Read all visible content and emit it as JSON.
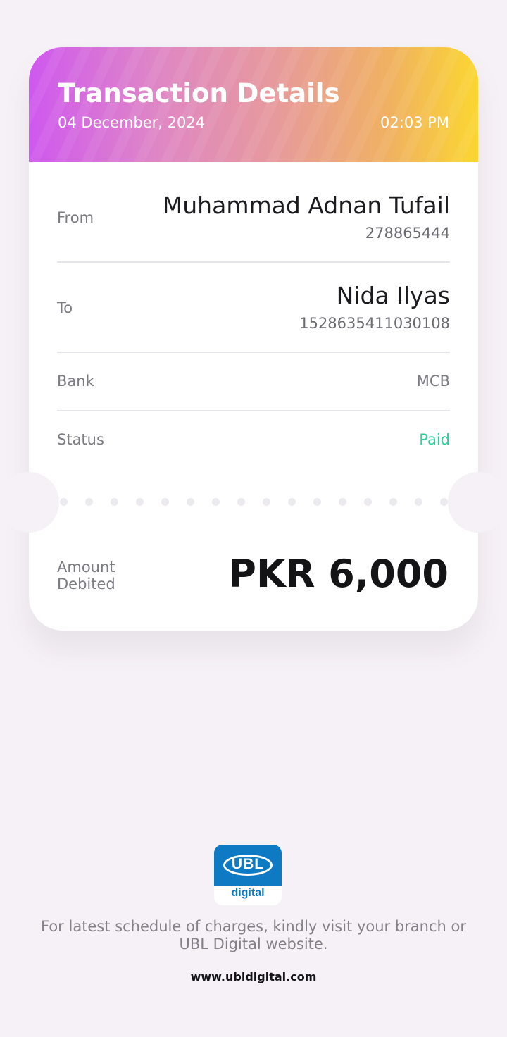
{
  "header": {
    "title": "Transaction Details",
    "date": "04 December, 2024",
    "time": "02:03 PM"
  },
  "details": {
    "from": {
      "label": "From",
      "name": "Muhammad Adnan Tufail",
      "account": "278865444"
    },
    "to": {
      "label": "To",
      "name": "Nida Ilyas",
      "account": "1528635411030108"
    },
    "bank": {
      "label": "Bank",
      "value": "MCB"
    },
    "status": {
      "label": "Status",
      "value": "Paid",
      "color": "#2ecf99"
    }
  },
  "amount": {
    "label": "Amount Debited",
    "value": "PKR 6,000"
  },
  "footer": {
    "logo_text": "UBL",
    "logo_subtext": "digital",
    "note": "For latest schedule of charges, kindly visit your branch or UBL Digital website.",
    "url": "www.ubldigital.com"
  },
  "colors": {
    "background": "#f6f1f6",
    "header_gradient": [
      "#cf58ef",
      "#de86c6",
      "#e79a9c",
      "#f0b162",
      "#fbd631"
    ],
    "ubl_blue": "#0e7ac4"
  }
}
